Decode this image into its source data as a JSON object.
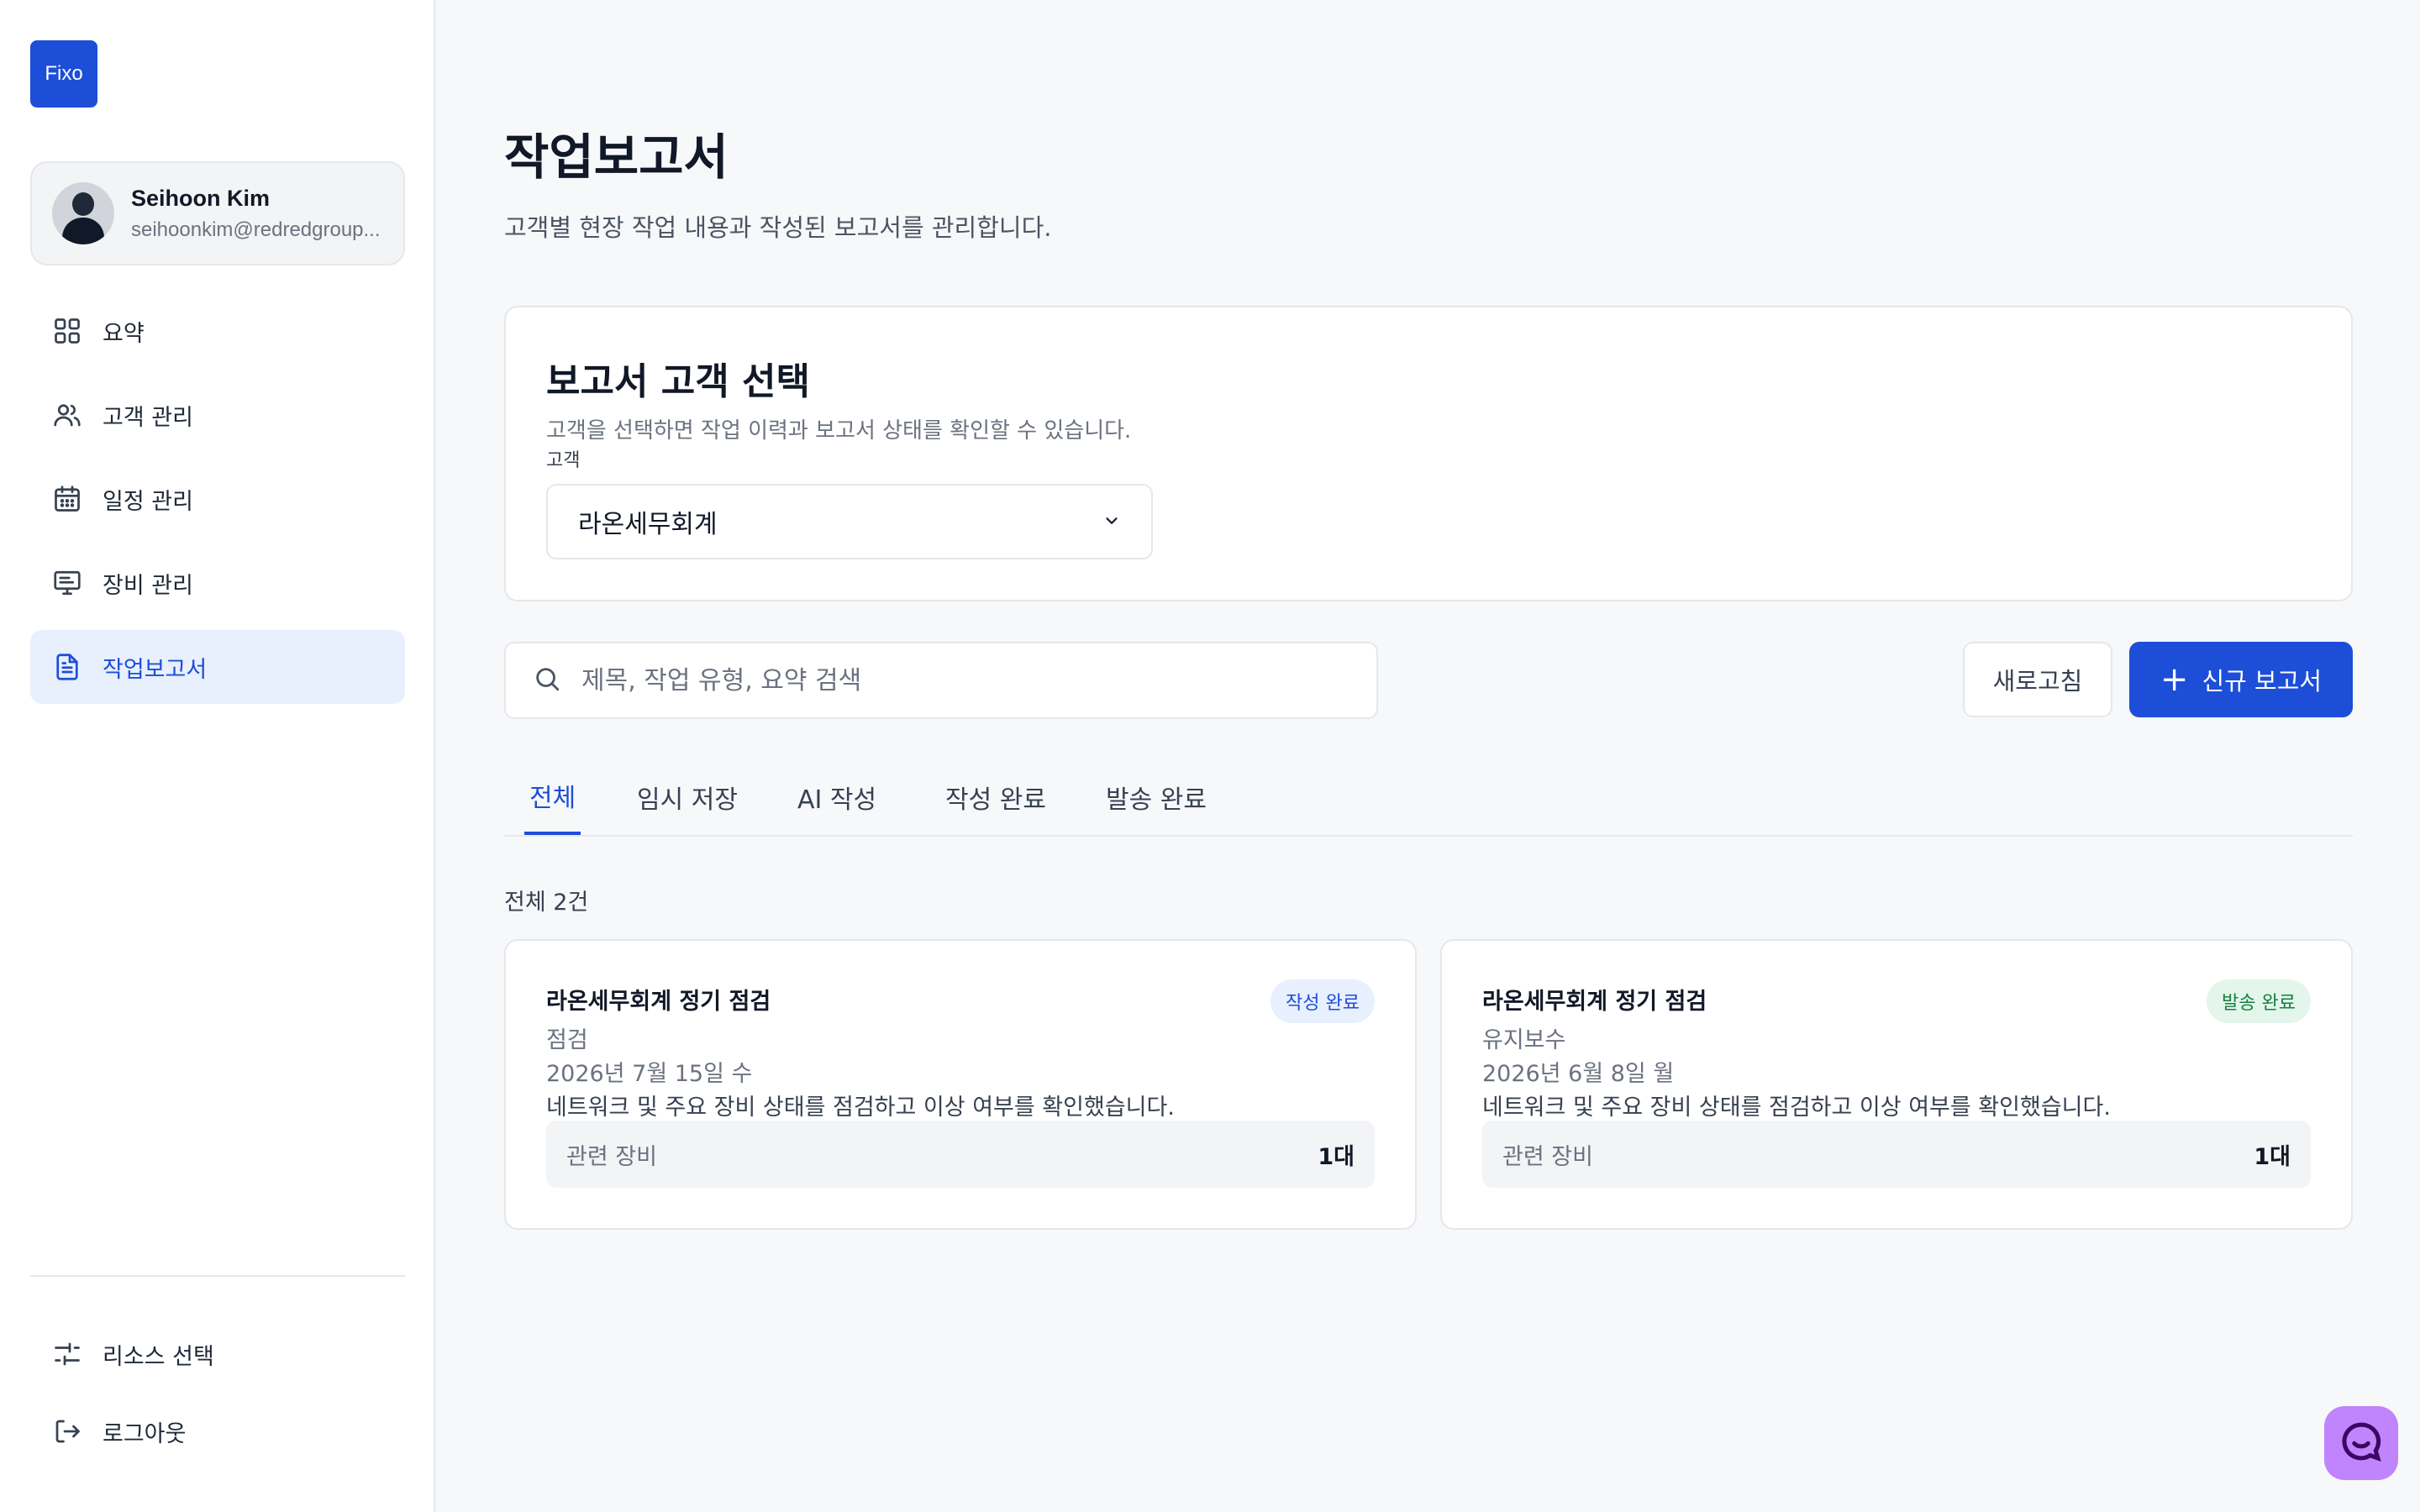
{
  "app": {
    "logo": "Fixo"
  },
  "user": {
    "name": "Seihoon Kim",
    "email": "seihoonkim@redredgroup..."
  },
  "sidebar": {
    "items": [
      {
        "label": "요약",
        "icon": "grid-icon"
      },
      {
        "label": "고객 관리",
        "icon": "users-icon"
      },
      {
        "label": "일정 관리",
        "icon": "calendar-icon"
      },
      {
        "label": "장비 관리",
        "icon": "monitor-icon"
      },
      {
        "label": "작업보고서",
        "icon": "document-icon",
        "active": true
      }
    ],
    "bottom": [
      {
        "label": "리소스 선택",
        "icon": "sliders-icon"
      },
      {
        "label": "로그아웃",
        "icon": "logout-icon"
      }
    ]
  },
  "page": {
    "title": "작업보고서",
    "subtitle": "고객별 현장 작업 내용과 작성된 보고서를 관리합니다."
  },
  "customer_select": {
    "title": "보고서 고객 선택",
    "description": "고객을 선택하면 작업 이력과 보고서 상태를 확인할 수 있습니다.",
    "label": "고객",
    "selected": "라온세무회계"
  },
  "search": {
    "placeholder": "제목, 작업 유형, 요약 검색"
  },
  "toolbar": {
    "refresh_label": "새로고침",
    "new_label": "신규 보고서"
  },
  "tabs": [
    {
      "label": "전체",
      "active": true
    },
    {
      "label": "임시 저장"
    },
    {
      "label": "AI 작성"
    },
    {
      "label": "작성 완료"
    },
    {
      "label": "발송 완료"
    }
  ],
  "count_label": "전체 2건",
  "reports": [
    {
      "title": "라온세무회계 정기 점검",
      "type": "점검",
      "date": "2026년 7월 15일 수",
      "summary": "네트워크 및 주요 장비 상태를 점검하고 이상 여부를 확인했습니다.",
      "status": "작성 완료",
      "status_color": "#1d4ed8",
      "equipment_label": "관련 장비",
      "equipment_value": "1대"
    },
    {
      "title": "라온세무회계 정기 점검",
      "type": "유지보수",
      "date": "2026년 6월 8일 월",
      "summary": "네트워크 및 주요 장비 상태를 점검하고 이상 여부를 확인했습니다.",
      "status": "발송 완료",
      "status_color": "#15803d",
      "equipment_label": "관련 장비",
      "equipment_value": "1대"
    }
  ],
  "colors": {
    "accent": "#1d4ed8",
    "chat_fab": "#c084fc"
  }
}
